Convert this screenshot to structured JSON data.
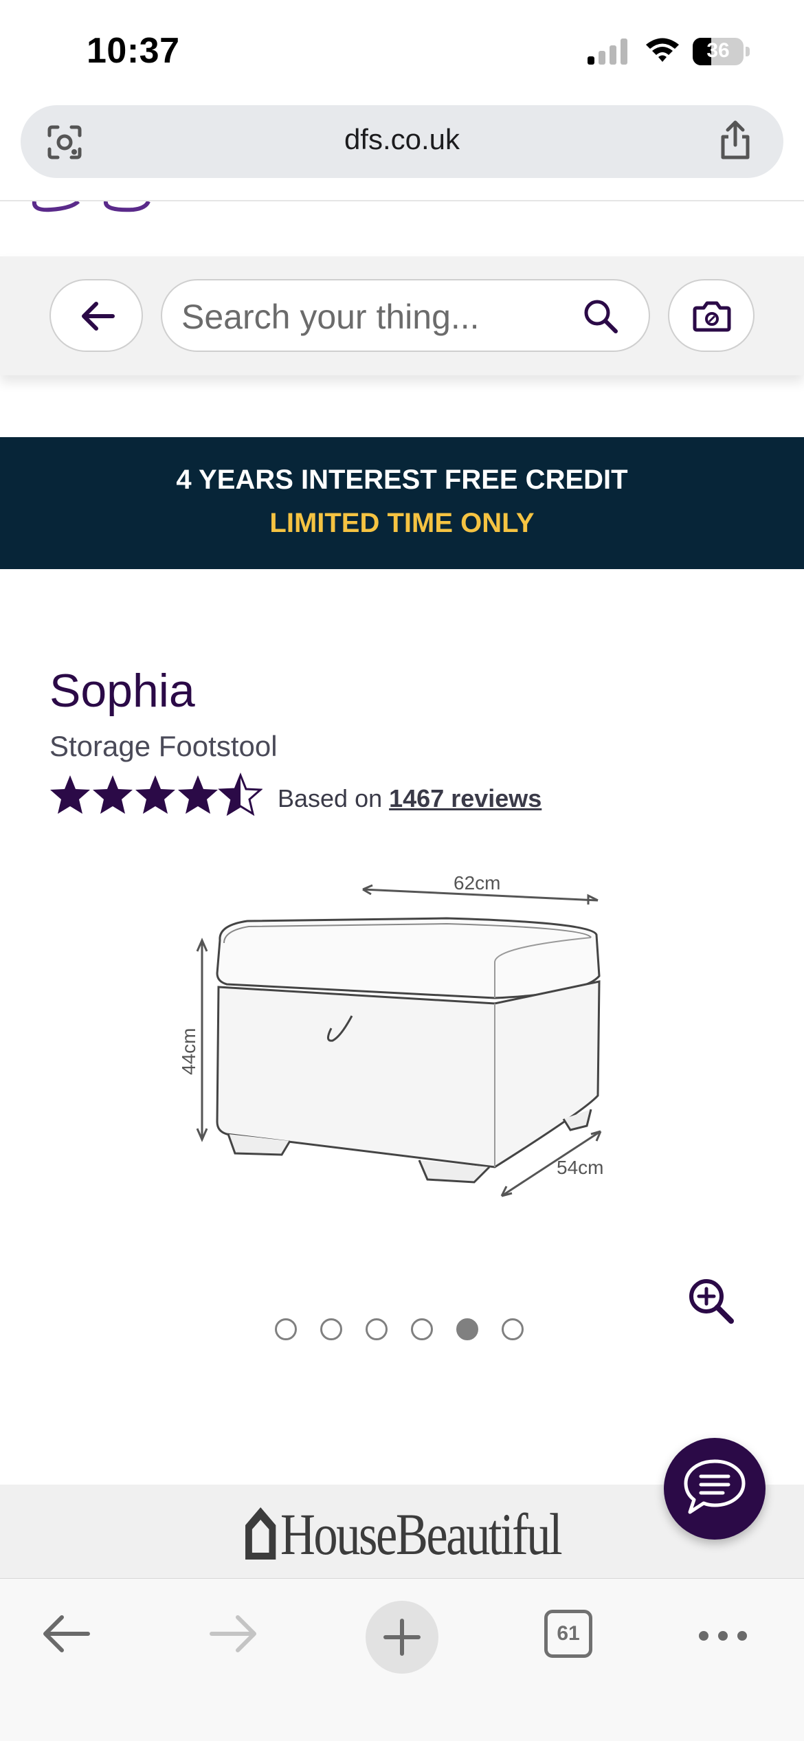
{
  "status_bar": {
    "time": "10:37",
    "battery": "36"
  },
  "browser": {
    "url": "dfs.co.uk",
    "tab_count": "61"
  },
  "search": {
    "placeholder": "Search your thing..."
  },
  "banner": {
    "line1": "4 YEARS INTEREST FREE CREDIT",
    "line2": "LIMITED TIME ONLY"
  },
  "product": {
    "title": "Sophia",
    "subtitle": "Storage Footstool",
    "rating": 4.5,
    "rating_max": 5,
    "reviews_prefix": "Based on ",
    "reviews_link": "1467 reviews",
    "dimensions": {
      "width": "62cm",
      "height": "44cm",
      "depth": "54cm"
    }
  },
  "carousel": {
    "total": 6,
    "active_index": 4
  },
  "press_logo": "HouseBeautiful",
  "colors": {
    "brand_purple": "#2b0a47",
    "banner_bg": "#072538",
    "banner_accent": "#f5c342"
  },
  "icons": [
    "lens-icon",
    "share-icon",
    "back-arrow-icon",
    "search-icon",
    "camera-icon",
    "star-icon",
    "zoom-in-icon",
    "chat-icon",
    "plus-icon",
    "more-icon"
  ]
}
